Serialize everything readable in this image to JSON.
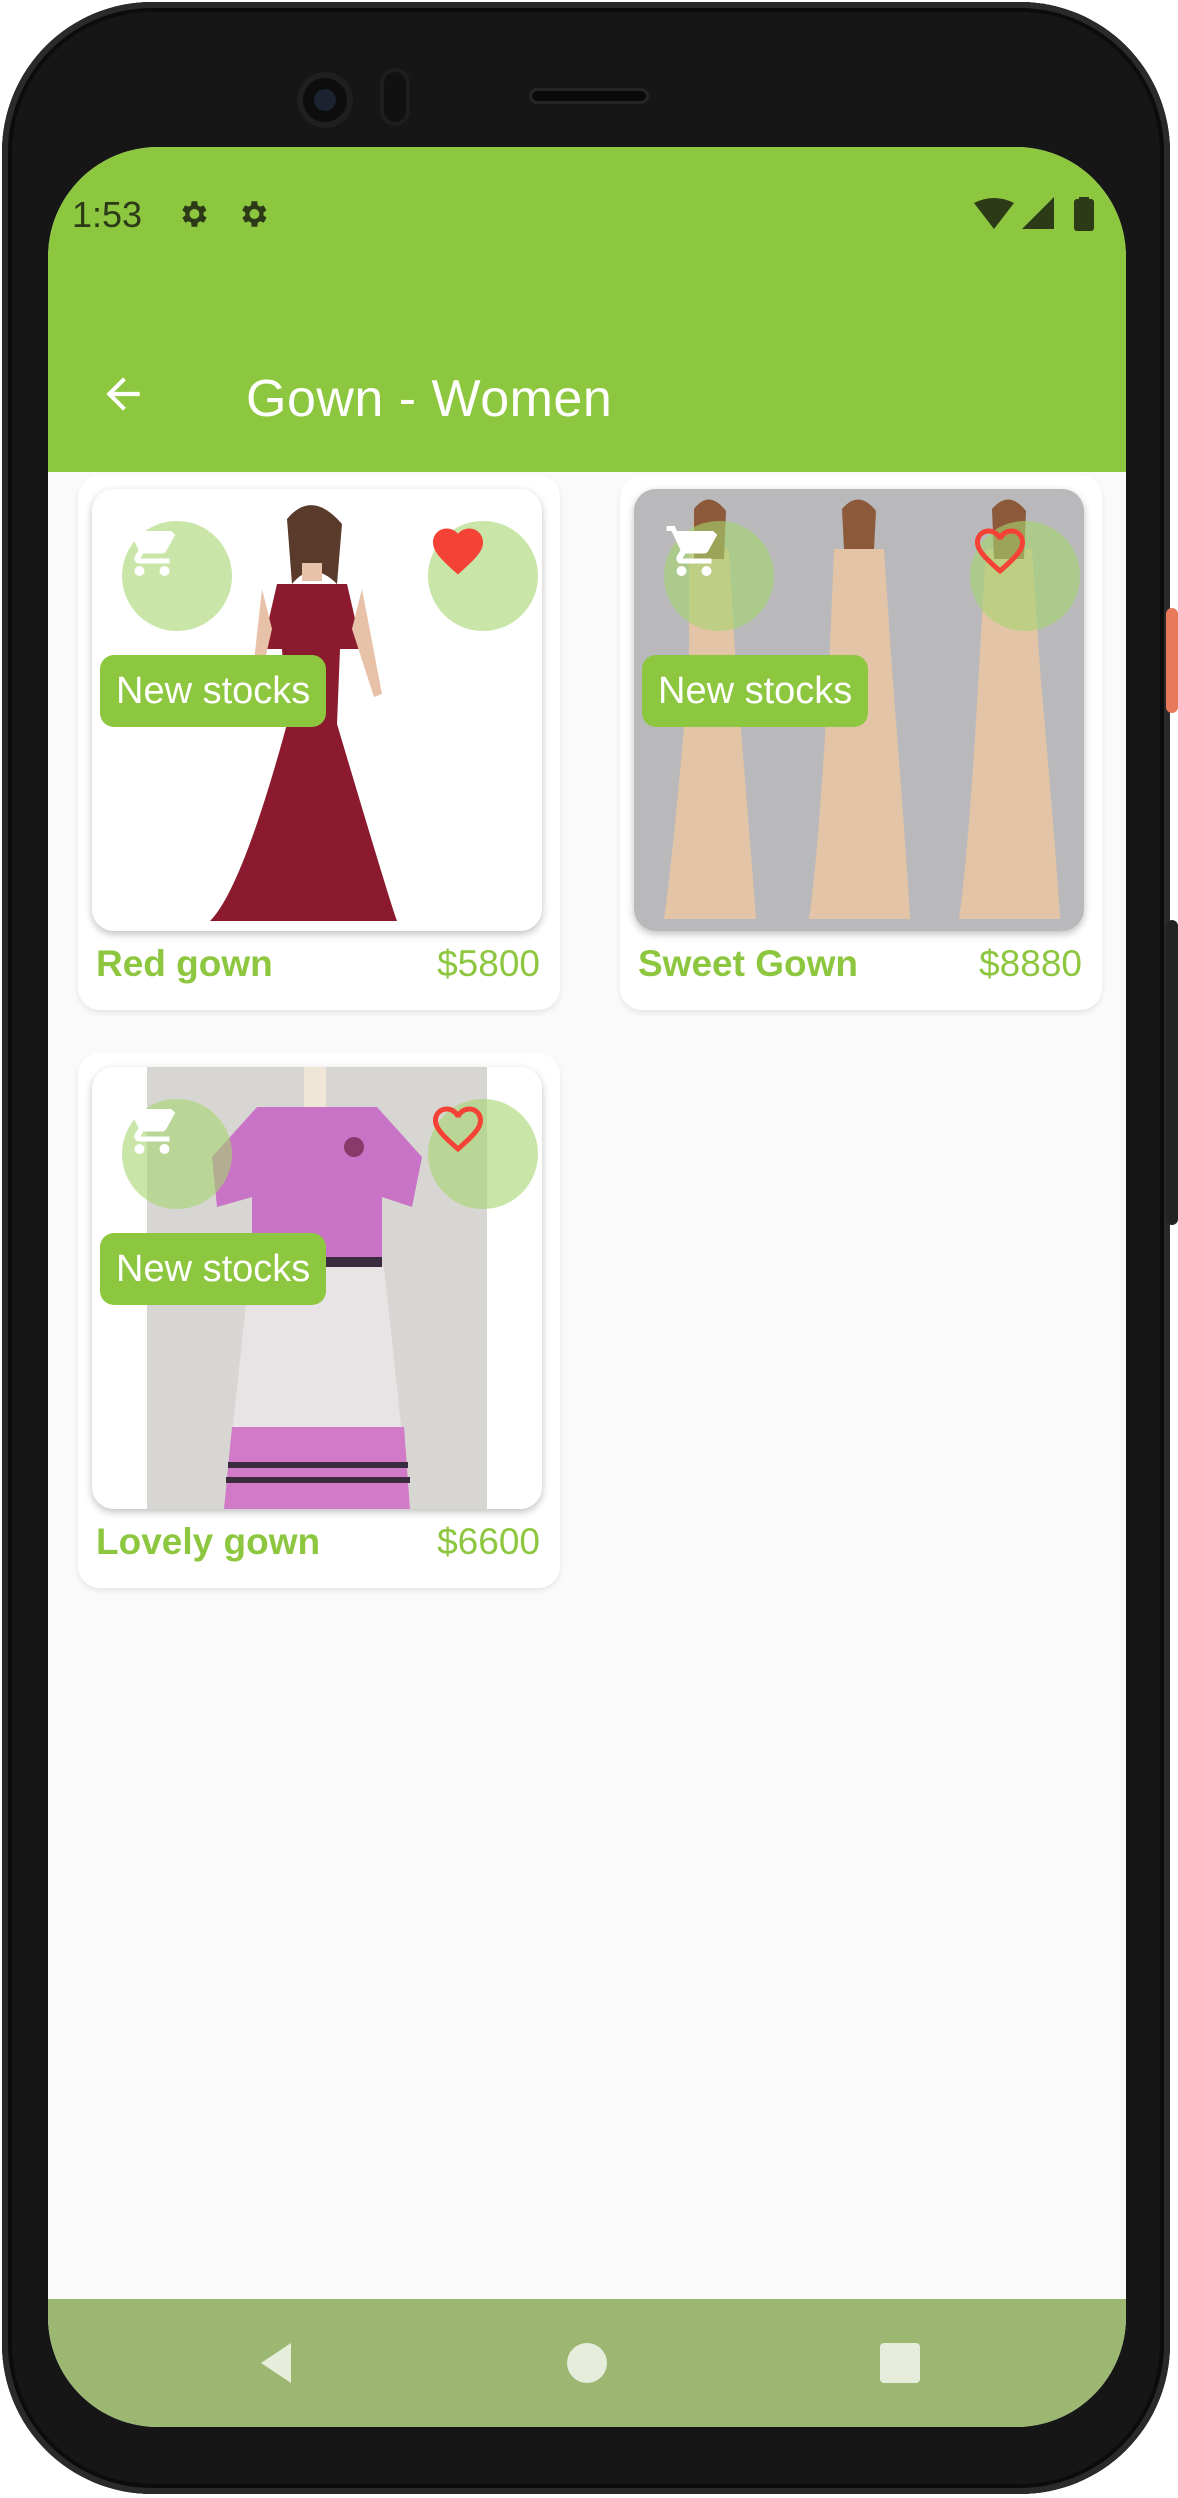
{
  "status_bar": {
    "time": "1:53",
    "left_icons": [
      "gear-icon",
      "gear-icon"
    ],
    "right_icons": [
      "wifi-icon",
      "signal-icon",
      "battery-icon"
    ]
  },
  "app_bar": {
    "title": "Gown - Women",
    "back_icon": "arrow-left-icon",
    "color": "#8dc63f"
  },
  "products": [
    {
      "name": "Red gown",
      "price": "$5800",
      "badge": "New stocks",
      "favorite": true
    },
    {
      "name": "Sweet Gown",
      "price": "$8880",
      "badge": "New stocks",
      "favorite": false
    },
    {
      "name": "Lovely gown",
      "price": "$6600",
      "badge": "New stocks",
      "favorite": false
    }
  ],
  "colors": {
    "accent": "#8dc63f",
    "favorite": "#f44336",
    "nav_bar": "#9bb772",
    "background": "#fafafa"
  },
  "nav_bar": {
    "icons": [
      "back-triangle-icon",
      "home-circle-icon",
      "recents-square-icon"
    ]
  }
}
